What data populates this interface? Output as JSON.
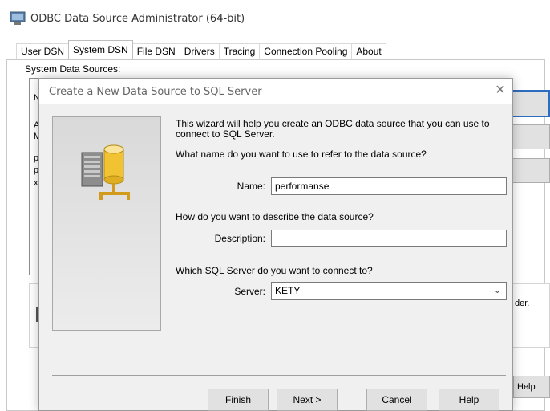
{
  "bg_window": {
    "title": "ODBC Data Source Administrator (64-bit)",
    "tabs": [
      "User DSN",
      "System DSN",
      "File DSN",
      "Drivers",
      "Tracing",
      "Connection Pooling",
      "About"
    ],
    "active_tab": "System DSN",
    "system_dsn_label": "System Data Sources:",
    "list_letters": [
      "N",
      "A",
      "M",
      "p",
      "p",
      "x"
    ],
    "info_text_fragment": "der.",
    "help_button": "Help"
  },
  "dialog": {
    "title": "Create a New Data Source to SQL Server",
    "close_glyph": "✕",
    "intro": "This wizard will help you create an ODBC data source that you can use to connect to SQL Server.",
    "name_question": "What name do you want to use to refer to the data source?",
    "name_label": "Name:",
    "name_value": "performanse",
    "description_question": "How do you want to describe the data source?",
    "description_label": "Description:",
    "description_value": "",
    "server_question": "Which SQL Server do you want to connect to?",
    "server_label": "Server:",
    "server_value": "KETY",
    "buttons": {
      "finish": "Finish",
      "next": "Next >",
      "cancel": "Cancel",
      "help": "Help"
    }
  }
}
